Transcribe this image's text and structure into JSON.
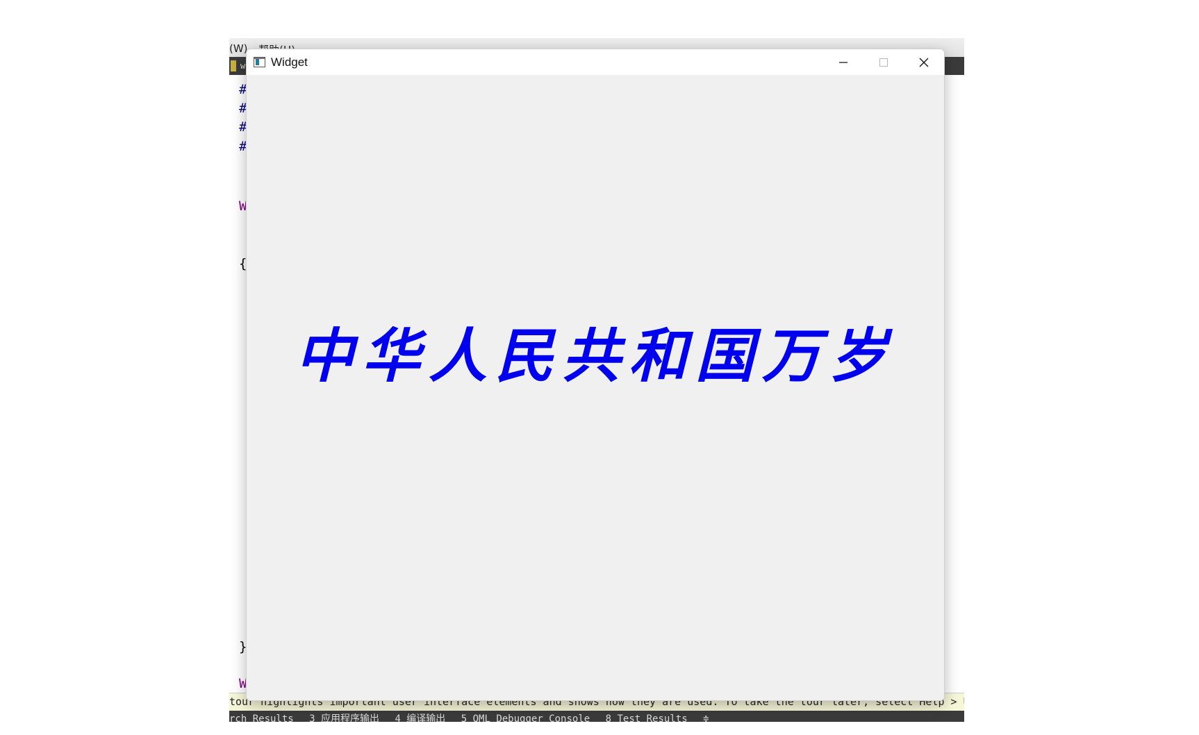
{
  "background_ide": {
    "menu_items": [
      "(W)",
      "帮助(H)"
    ],
    "tab_label": "w",
    "code_lines": [
      {
        "text": "#",
        "kind": "pre"
      },
      {
        "text": "#",
        "kind": "pre"
      },
      {
        "text": "#",
        "kind": "pre"
      },
      {
        "text": "#",
        "kind": "pre"
      },
      {
        "text": "W",
        "kind": "kw"
      },
      {
        "text": "{",
        "kind": "plain"
      },
      {
        "text": "}",
        "kind": "plain"
      },
      {
        "text": "W",
        "kind": "kw"
      }
    ],
    "hint_text": "tour highlights important user interface elements and shows how they are used. To take the tour later, select Help > UI Tour.",
    "output_panes": [
      "rch Results",
      "3 应用程序输出",
      "4 编译输出",
      "5 QML Debugger Console",
      "8 Test Results",
      "≑"
    ]
  },
  "window": {
    "title": "Widget",
    "icons": {
      "app": "qt-widget-app-icon",
      "minimize": "minimize-icon",
      "maximize": "maximize-icon",
      "close": "close-icon"
    },
    "content_text": "中华人民共和国万岁",
    "content_text_color": "#0000ee"
  }
}
